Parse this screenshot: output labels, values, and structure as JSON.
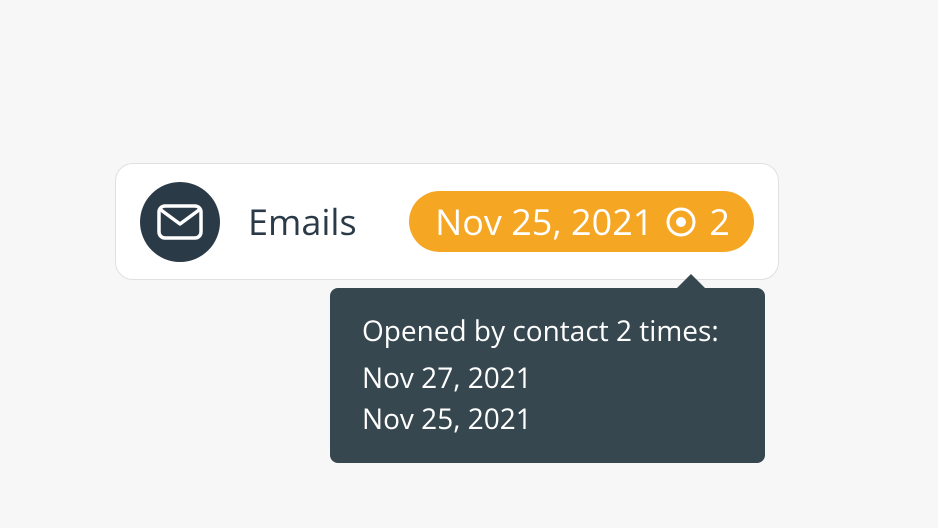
{
  "card": {
    "label": "Emails",
    "badge": {
      "date": "Nov 25, 2021",
      "count": "2"
    }
  },
  "tooltip": {
    "header": "Opened by contact 2 times:",
    "dates": [
      "Nov 27, 2021",
      "Nov 25, 2021"
    ]
  }
}
